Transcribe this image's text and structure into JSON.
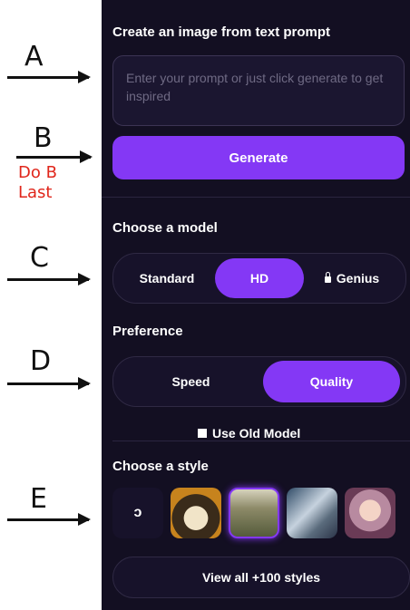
{
  "annotations": {
    "letters": [
      "A",
      "B",
      "C",
      "D",
      "E"
    ],
    "note_line1": "Do B",
    "note_line2": "Last",
    "note_color": "#e0261b"
  },
  "panel": {
    "title": "Create an image from text prompt",
    "prompt_placeholder": "Enter your prompt or just click generate to get inspired",
    "generate_label": "Generate",
    "model_heading": "Choose a model",
    "models": [
      {
        "label": "Standard",
        "active": false
      },
      {
        "label": "HD",
        "active": true
      },
      {
        "label": "Genius",
        "active": false,
        "locked": true
      }
    ],
    "preference_heading": "Preference",
    "preferences": [
      {
        "label": "Speed",
        "active": false
      },
      {
        "label": "Quality",
        "active": true
      }
    ],
    "old_model_label": "Use Old Model",
    "style_heading": "Choose a style",
    "styles": [
      {
        "icon": "no-style-icon",
        "glyph": "ɔ"
      },
      {
        "icon": "panda-thumbnail"
      },
      {
        "icon": "forest-thumbnail",
        "selected": true
      },
      {
        "icon": "robot-thumbnail"
      },
      {
        "icon": "girl-thumbnail"
      }
    ],
    "view_all_label": "View all +100 styles",
    "accent_color": "#8438f5",
    "background_color": "#130f22"
  }
}
